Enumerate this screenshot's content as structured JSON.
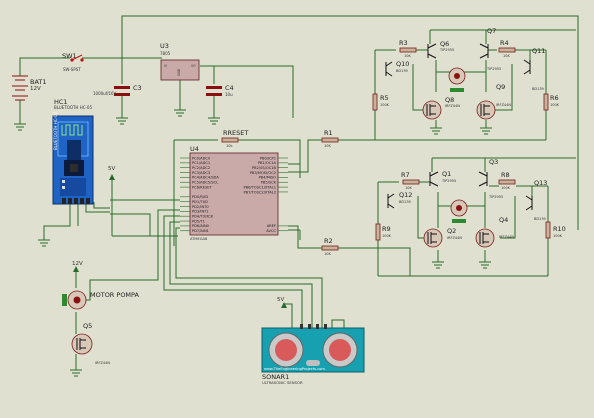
{
  "components": {
    "bat1": {
      "ref": "BAT1",
      "value": "12V"
    },
    "sw1": {
      "ref": "SW1",
      "value": "SW-SPST"
    },
    "u3": {
      "ref": "U3",
      "value": "7805",
      "pin_vi": "VI",
      "pin_vo": "VO",
      "pin_gnd": "GND"
    },
    "c3": {
      "ref": "C3",
      "value": "1000uf/16V"
    },
    "c4": {
      "ref": "C4",
      "value": "10u"
    },
    "hc1": {
      "ref": "HC1",
      "value": "BLUETOOTH HC-05"
    },
    "rreset": {
      "ref": "RRESET",
      "value": "10k"
    },
    "u4": {
      "ref": "U4",
      "value": "ATMEGA8",
      "left_pins": [
        "PC0/ADC0",
        "PC1/ADC1",
        "PC2/ADC2",
        "PC3/ADC3",
        "PC4/ADC4/SDA",
        "PC5/ADC5/SCL",
        "PC6/RESET",
        "",
        "PD0/RXD",
        "PD1/TXD",
        "PD2/INT0",
        "PD3/INT1",
        "PD4/T0/XCK",
        "PD5/T1",
        "PD6/AIN0",
        "PD7/AIN1"
      ],
      "right_pins": [
        "PB0/ICP1",
        "PB1/OC1A",
        "PB2/SS/OC1B",
        "PB3/MOSI/OC2",
        "PB4/MISO",
        "PB5/SCK",
        "PB6/TOSC1/XTAL1",
        "PB7/TOSC2/XTAL2",
        "",
        "",
        "",
        "",
        "",
        "",
        "AREF",
        "AVCC"
      ]
    },
    "r1": {
      "ref": "R1",
      "value": "10K"
    },
    "r2": {
      "ref": "R2",
      "value": "10K"
    },
    "r3": {
      "ref": "R3",
      "value": "10K"
    },
    "r4": {
      "ref": "R4",
      "value": "10K"
    },
    "r5": {
      "ref": "R5",
      "value": "100K"
    },
    "r6": {
      "ref": "R6",
      "value": "100K"
    },
    "r7": {
      "ref": "R7",
      "value": "10K"
    },
    "r8": {
      "ref": "R8",
      "value": "100K"
    },
    "r9": {
      "ref": "R9",
      "value": "100K"
    },
    "r10": {
      "ref": "R10",
      "value": "100K"
    },
    "q1": {
      "ref": "Q1",
      "value": "TIP2955"
    },
    "q2": {
      "ref": "Q2",
      "value": "IRFZ44N"
    },
    "q3": {
      "ref": "Q3",
      "value": "TIP2955"
    },
    "q4": {
      "ref": "Q4",
      "value": "IRFZ44N"
    },
    "q5": {
      "ref": "Q5",
      "value": "IRFZ44N"
    },
    "q6": {
      "ref": "Q6",
      "value": "TIP2955"
    },
    "q7": {
      "ref": "Q7",
      "value": "TIP2955"
    },
    "q8": {
      "ref": "Q8",
      "value": "IRFZ44N"
    },
    "q9": {
      "ref": "Q9",
      "value": "IRFZ44N"
    },
    "q10": {
      "ref": "Q10",
      "value": "BD139"
    },
    "q11": {
      "ref": "Q11",
      "value": "BD139"
    },
    "q12": {
      "ref": "Q12",
      "value": "BD139"
    },
    "q13": {
      "ref": "Q13",
      "value": "BD139"
    },
    "motor": {
      "ref": "MOTOR POMPA"
    },
    "sonar": {
      "ref": "SONAR1",
      "value": "ULTRASONIC SENSOR",
      "site": "www.TheEngineeringProjects.com"
    }
  },
  "supplies": {
    "v12_top": "12V",
    "v5_mid": "5V",
    "v5_sonar": "5V"
  },
  "colors": {
    "background": "#dfe0d0",
    "wire": "#2a6b2a",
    "component": "#8a1010",
    "bluetooth_board": "#1f63c4",
    "sonar_board": "#17a1b0"
  }
}
